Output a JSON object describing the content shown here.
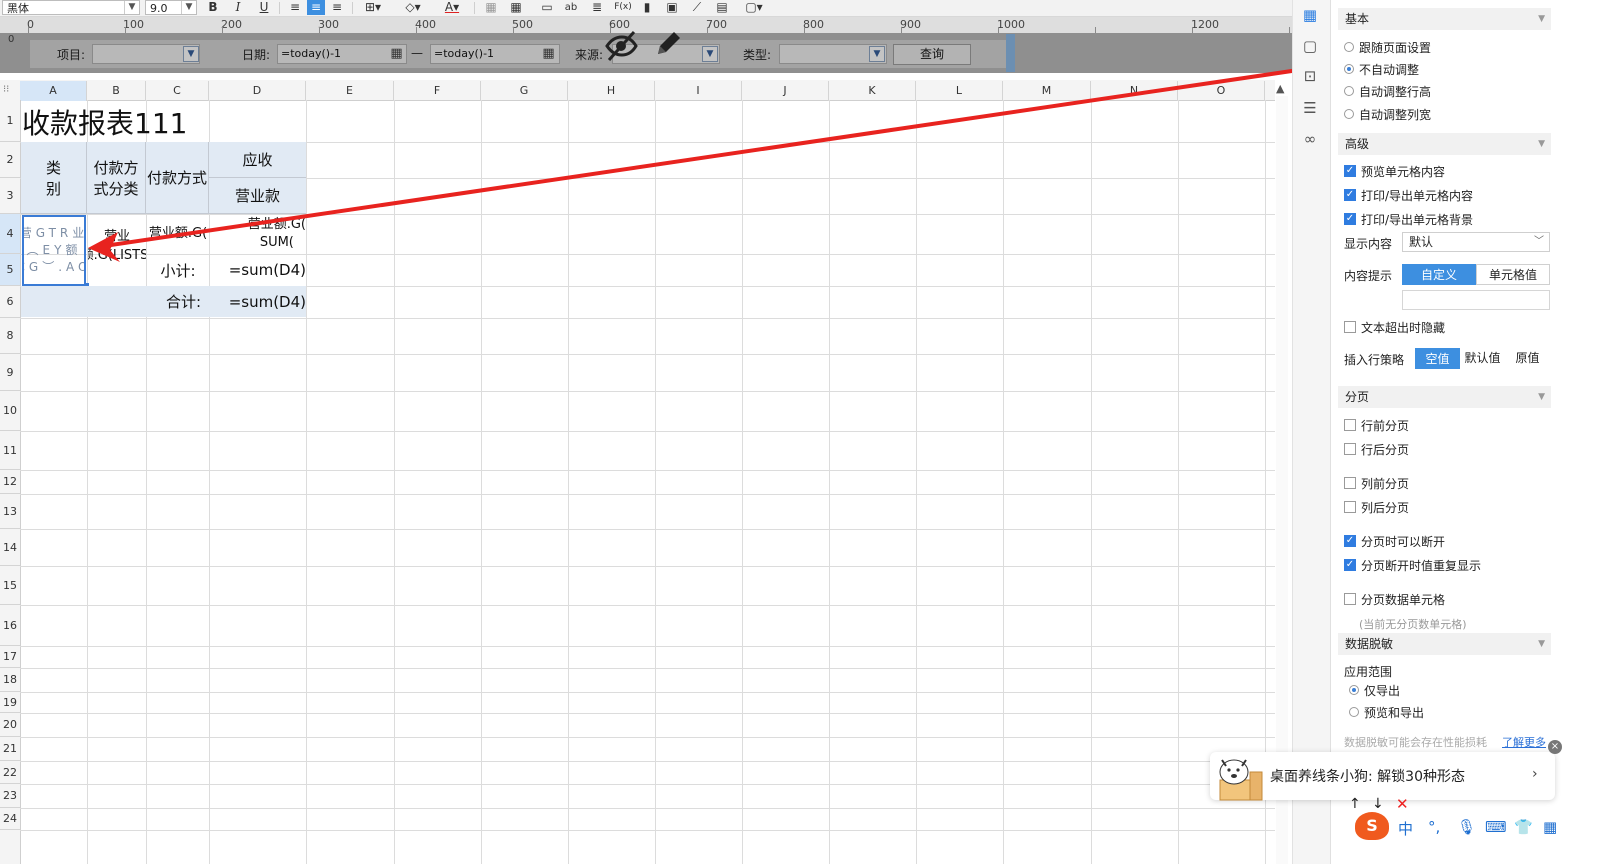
{
  "toolbar": {
    "font_name": "黑体",
    "font_size": "9.0",
    "bold": "B",
    "italic": "I",
    "underline": "U",
    "abc_label": "ab",
    "fx_label": "F(x)"
  },
  "ruler": {
    "ticks": [
      "0",
      "100",
      "200",
      "300",
      "400",
      "500",
      "600",
      "700",
      "800",
      "900",
      "1000",
      "1200"
    ]
  },
  "params": {
    "item_label": "项目:",
    "item_value": "",
    "date_label": "日期:",
    "date_from": "=today()-1",
    "date_sep": "—",
    "date_to": "=today()-1",
    "source_label": "来源:",
    "type_label": "类型:",
    "query_label": "查询"
  },
  "grid": {
    "columns": [
      "A",
      "B",
      "C",
      "D",
      "E",
      "F",
      "G",
      "H",
      "I",
      "J",
      "K",
      "L",
      "M",
      "N",
      "O"
    ],
    "rows": [
      "1",
      "2",
      "3",
      "4",
      "5",
      "6",
      "8",
      "9",
      "10",
      "11",
      "12",
      "13",
      "14",
      "15",
      "16",
      "17",
      "18",
      "19",
      "20",
      "21",
      "22",
      "23",
      "24"
    ],
    "cells": {
      "title": "收款报表111",
      "category_header": "类\n别",
      "pay_method_class": "付款方式分类",
      "pay_method": "付款方式",
      "receivable": "应收",
      "business_income": "营业款",
      "a4_formula": "营GTR业︵EY额CG︶.AO",
      "b4_formula": "营业额.G(LISTS)",
      "c4_formula": "营业额.G(",
      "d4_formula": "营业额.G(\nSUM(",
      "subtotal_label": "小计:",
      "subtotal_formula": "=sum(D4)",
      "total_label": "合计:",
      "total_formula": "=sum(D4)"
    }
  },
  "properties": {
    "basic": {
      "title": "基本",
      "options": [
        {
          "label": "跟随页面设置",
          "selected": false
        },
        {
          "label": "不自动调整",
          "selected": true
        },
        {
          "label": "自动调整行高",
          "selected": false
        },
        {
          "label": "自动调整列宽",
          "selected": false
        }
      ]
    },
    "advanced": {
      "title": "高级",
      "preview_content": {
        "label": "预览单元格内容",
        "checked": true
      },
      "print_content": {
        "label": "打印/导出单元格内容",
        "checked": true
      },
      "print_background": {
        "label": "打印/导出单元格背景",
        "checked": true
      },
      "display_content_label": "显示内容",
      "display_content_value": "默认",
      "content_tip_label": "内容提示",
      "content_tip_custom": "自定义",
      "content_tip_cell": "单元格值",
      "hide_overflow": {
        "label": "文本超出时隐藏",
        "checked": false
      },
      "insert_strategy_label": "插入行策略",
      "insert_empty": "空值",
      "insert_default": "默认值",
      "insert_original": "原值"
    },
    "paging": {
      "title": "分页",
      "row_before": {
        "label": "行前分页",
        "checked": false
      },
      "row_after": {
        "label": "行后分页",
        "checked": false
      },
      "col_before": {
        "label": "列前分页",
        "checked": false
      },
      "col_after": {
        "label": "列后分页",
        "checked": false
      },
      "can_break": {
        "label": "分页时可以断开",
        "checked": true
      },
      "repeat_on_break": {
        "label": "分页断开时值重复显示",
        "checked": true
      },
      "paging_data_cell": {
        "label": "分页数据单元格",
        "checked": false
      },
      "no_paging_cell_note": "(当前无分页数单元格)"
    },
    "masking": {
      "title": "数据脱敏",
      "scope_label": "应用范围",
      "export_only": "仅导出",
      "preview_and_export": "预览和导出",
      "warning": "数据脱敏可能会存在性能损耗",
      "learn_more": "了解更多"
    }
  },
  "popup": {
    "text": "桌面养线条小狗: 解锁30种形态",
    "arrow": "›",
    "close": "×"
  },
  "ime": {
    "lang": "中"
  },
  "colors": {
    "accent": "#3d8fe0",
    "annotation_arrow": "#e8231f",
    "header_cell_bg": "#e1eaf4"
  }
}
